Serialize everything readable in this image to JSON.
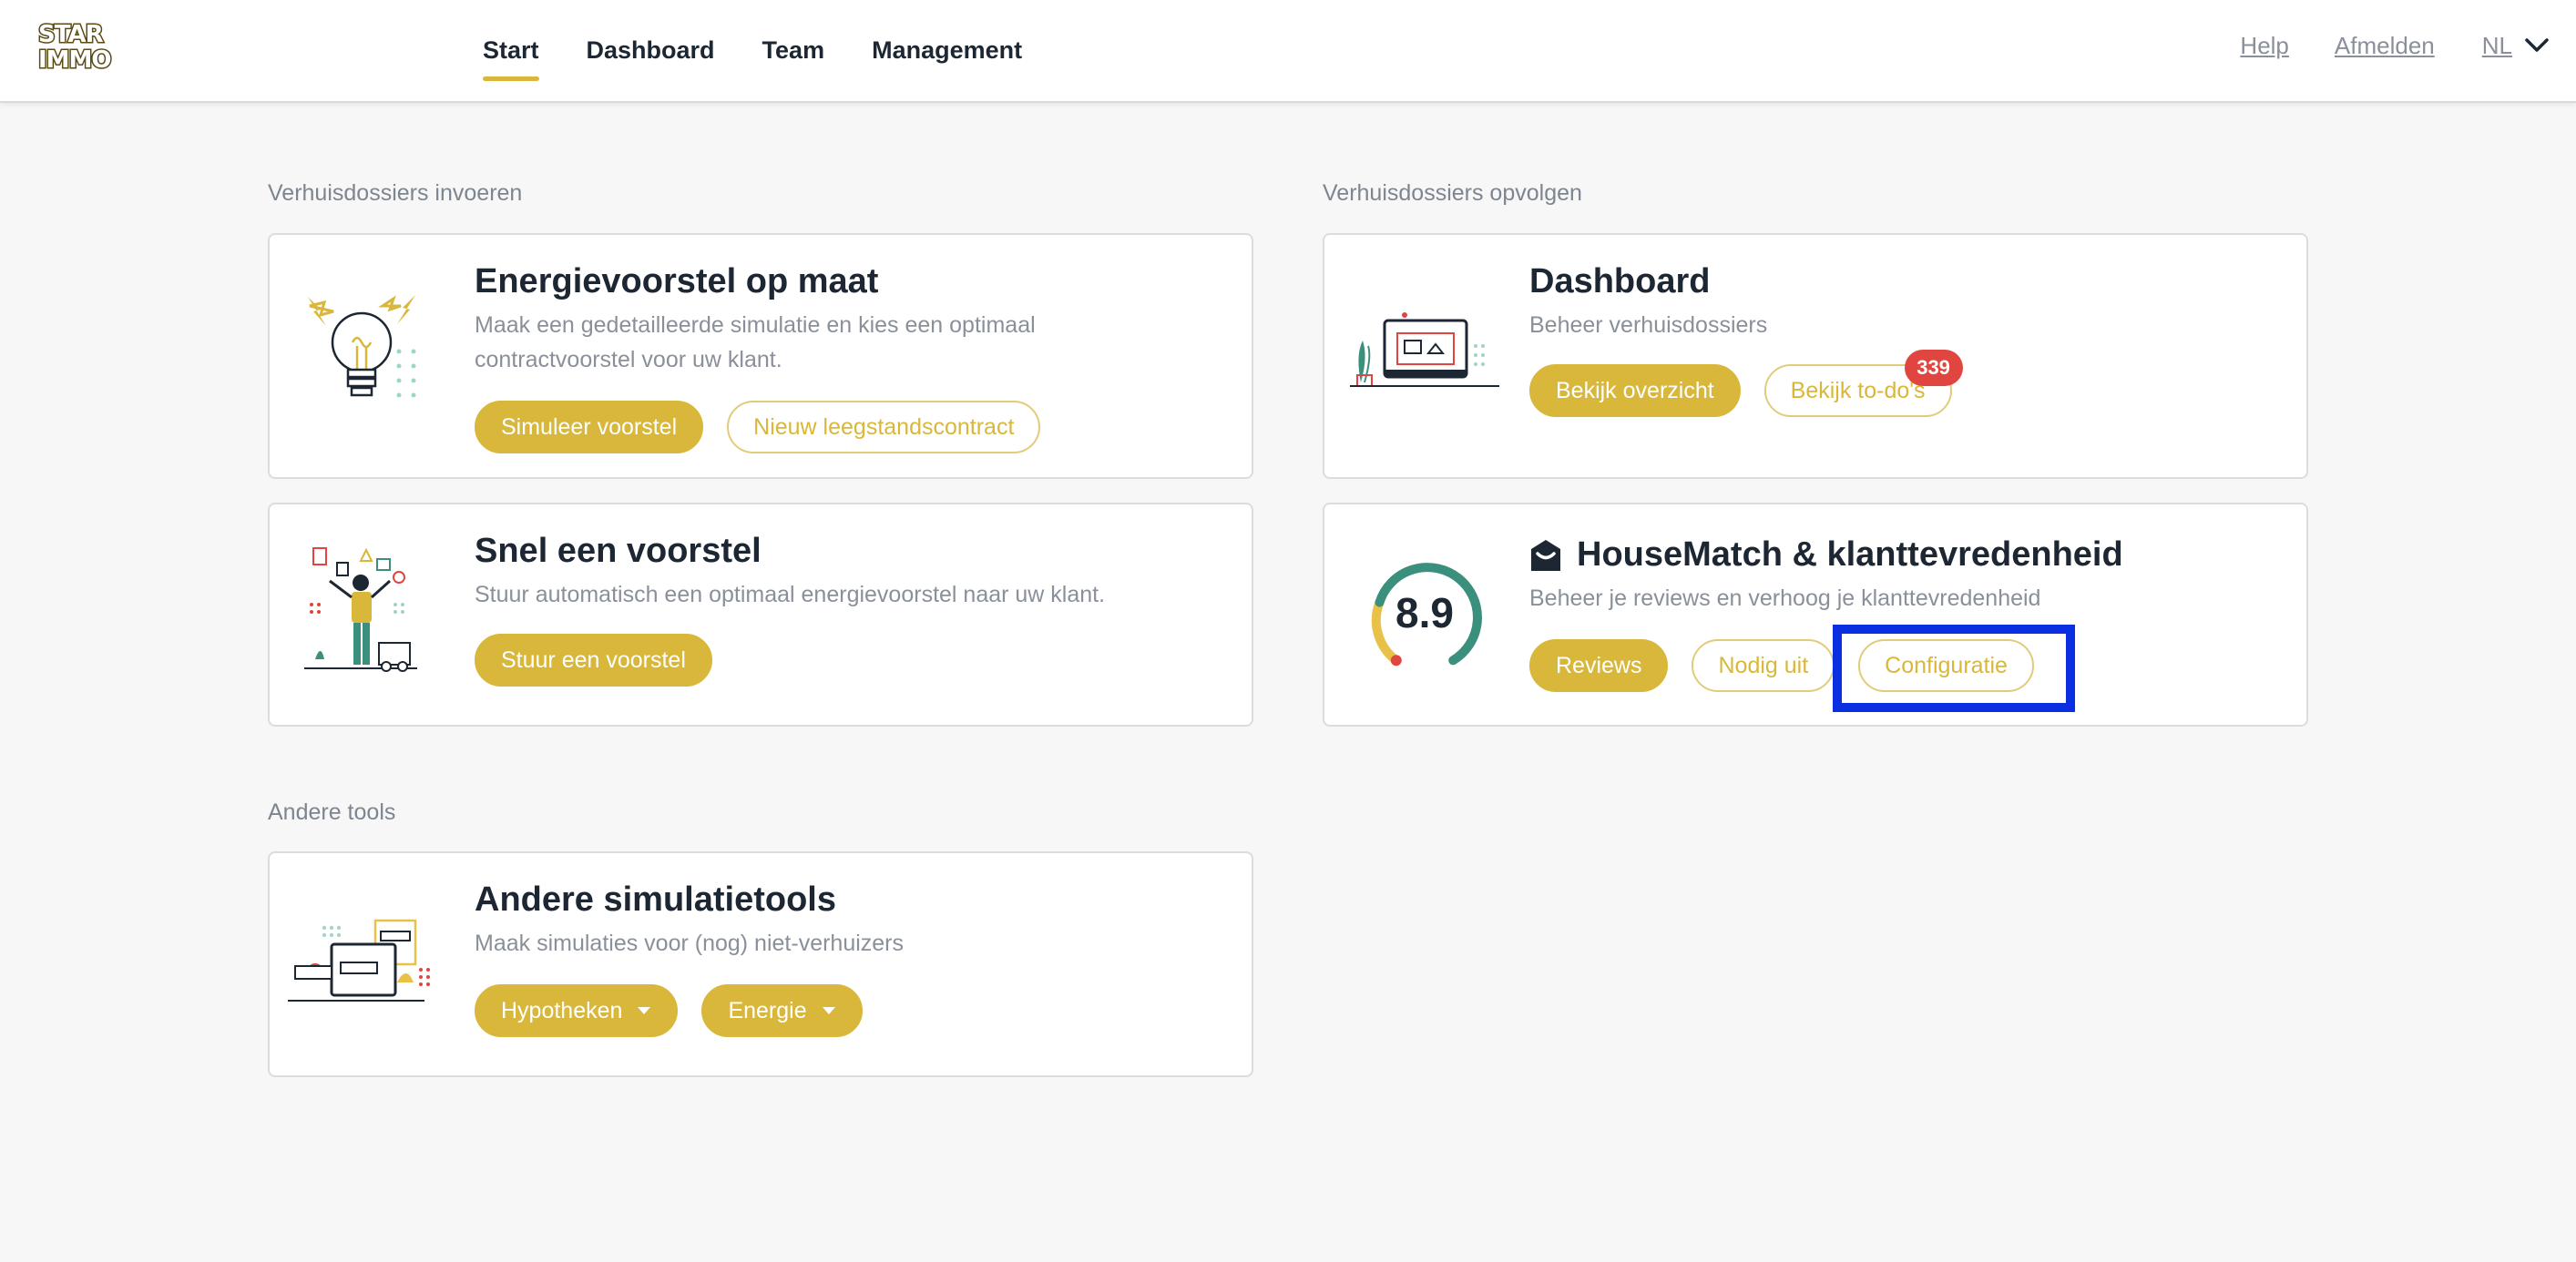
{
  "brand": {
    "logo_line1": "STAR",
    "logo_line2": "IMMO",
    "accent": "#d8b73a",
    "badge_color": "#e0463f"
  },
  "nav": {
    "items": [
      {
        "label": "Start",
        "active": true
      },
      {
        "label": "Dashboard",
        "active": false
      },
      {
        "label": "Team",
        "active": false
      },
      {
        "label": "Management",
        "active": false
      }
    ],
    "help": "Help",
    "logout": "Afmelden",
    "language": "NL",
    "language_icon": "chevron-down-icon"
  },
  "sections": {
    "enter": "Verhuisdossiers invoeren",
    "follow": "Verhuisdossiers opvolgen",
    "other": "Andere tools"
  },
  "cards": {
    "energy": {
      "title": "Energievoorstel op maat",
      "desc_line1": "Maak een gedetailleerde simulatie en kies een optimaal",
      "desc_line2": "contractvoorstel voor uw klant.",
      "btn_primary": "Simuleer voorstel",
      "btn_secondary": "Nieuw leegstandscontract",
      "icon": "lightbulb-icon"
    },
    "quick": {
      "title": "Snel een voorstel",
      "desc": "Stuur automatisch een optimaal energievoorstel naar uw klant.",
      "btn_primary": "Stuur een voorstel",
      "icon": "person-juggling-icon"
    },
    "dashboard": {
      "title": "Dashboard",
      "desc": "Beheer verhuisdossiers",
      "btn_primary": "Bekijk overzicht",
      "btn_secondary": "Bekijk to-do's",
      "badge": "339",
      "icon": "laptop-icon"
    },
    "housematch": {
      "title": "HouseMatch & klanttevredenheid",
      "desc": "Beheer je reviews en verhoog je klanttevredenheid",
      "score": "8.9",
      "score_fraction": 0.89,
      "btn_reviews": "Reviews",
      "btn_invite": "Nodig uit",
      "btn_config": "Configuratie",
      "icon": "house-icon"
    },
    "tools": {
      "title": "Andere simulatietools",
      "desc": "Maak simulaties voor (nog) niet-verhuizers",
      "btn_mortgage": "Hypotheken",
      "btn_energy": "Energie",
      "icon": "meters-icon",
      "dropdown_icon": "caret-down-icon"
    }
  }
}
